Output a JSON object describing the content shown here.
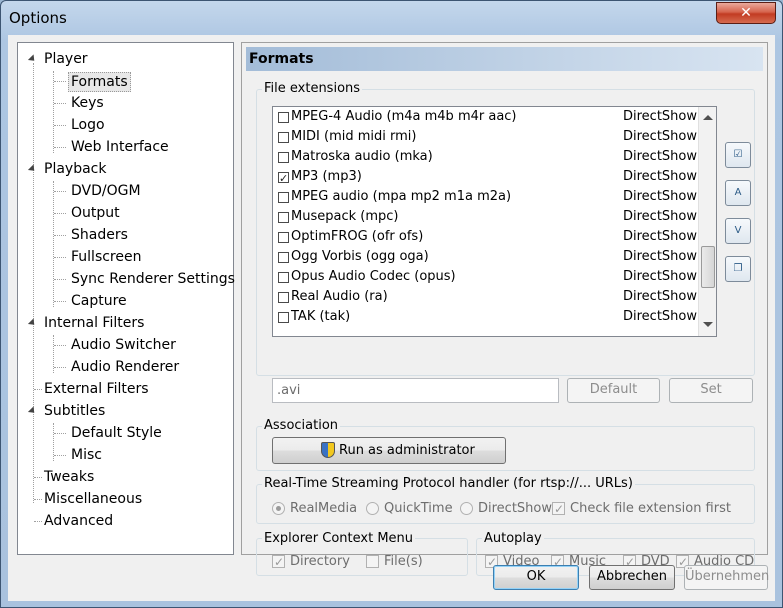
{
  "window": {
    "title": "Options",
    "close_label": "✕"
  },
  "tree": {
    "items": [
      {
        "label": "Player"
      },
      {
        "label": "Formats"
      },
      {
        "label": "Keys"
      },
      {
        "label": "Logo"
      },
      {
        "label": "Web Interface"
      },
      {
        "label": "Playback"
      },
      {
        "label": "DVD/OGM"
      },
      {
        "label": "Output"
      },
      {
        "label": "Shaders"
      },
      {
        "label": "Fullscreen"
      },
      {
        "label": "Sync Renderer Settings"
      },
      {
        "label": "Capture"
      },
      {
        "label": "Internal Filters"
      },
      {
        "label": "Audio Switcher"
      },
      {
        "label": "Audio Renderer"
      },
      {
        "label": "External Filters"
      },
      {
        "label": "Subtitles"
      },
      {
        "label": "Default Style"
      },
      {
        "label": "Misc"
      },
      {
        "label": "Tweaks"
      },
      {
        "label": "Miscellaneous"
      },
      {
        "label": "Advanced"
      }
    ]
  },
  "page": {
    "header": "Formats",
    "file_extensions": {
      "label": "File extensions",
      "rows": [
        {
          "name": "MPEG-4 Audio (m4a m4b m4r aac)",
          "handler": "DirectShow",
          "checked": false
        },
        {
          "name": "MIDI (mid midi rmi)",
          "handler": "DirectShow",
          "checked": false
        },
        {
          "name": "Matroska audio (mka)",
          "handler": "DirectShow",
          "checked": false
        },
        {
          "name": "MP3 (mp3)",
          "handler": "DirectShow",
          "checked": true
        },
        {
          "name": "MPEG audio (mpa mp2 m1a m2a)",
          "handler": "DirectShow",
          "checked": false
        },
        {
          "name": "Musepack (mpc)",
          "handler": "DirectShow",
          "checked": false
        },
        {
          "name": "OptimFROG (ofr ofs)",
          "handler": "DirectShow",
          "checked": false
        },
        {
          "name": "Ogg Vorbis (ogg oga)",
          "handler": "DirectShow",
          "checked": false
        },
        {
          "name": "Opus Audio Codec (opus)",
          "handler": "DirectShow",
          "checked": false
        },
        {
          "name": "Real Audio (ra)",
          "handler": "DirectShow",
          "checked": false
        },
        {
          "name": "TAK (tak)",
          "handler": "DirectShow",
          "checked": false
        }
      ],
      "ext_value": ".avi",
      "default_button": "Default",
      "set_button": "Set"
    },
    "association": {
      "label": "Association",
      "run_as_admin": "Run as administrator"
    },
    "rtsp": {
      "label": "Real-Time Streaming Protocol handler (for rtsp://... URLs)",
      "options": [
        "RealMedia",
        "QuickTime",
        "DirectShow"
      ],
      "selected": "RealMedia",
      "check_ext": "Check file extension first"
    },
    "explorer": {
      "label": "Explorer Context Menu",
      "directory": "Directory",
      "files": "File(s)"
    },
    "autoplay": {
      "label": "Autoplay",
      "video": "Video",
      "music": "Music",
      "dvd": "DVD",
      "audio_cd": "Audio CD"
    }
  },
  "footer": {
    "ok": "OK",
    "cancel": "Abbrechen",
    "apply": "Übernehmen"
  }
}
